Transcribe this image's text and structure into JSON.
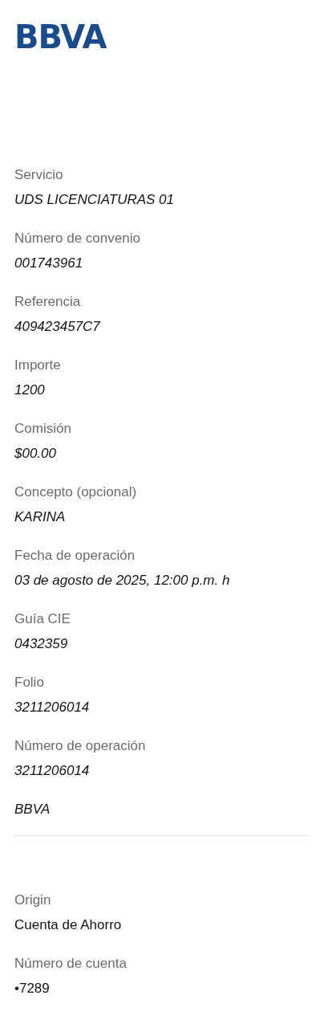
{
  "logo": "BBVA",
  "payment_details": [
    {
      "label": "Servicio",
      "value": "UDS LICENCIATURAS 01"
    },
    {
      "label": "Número de convenio",
      "value": "001743961"
    },
    {
      "label": "Referencia",
      "value": "409423457C7"
    },
    {
      "label": "Importe",
      "value": "1200"
    },
    {
      "label": "Comisión",
      "value": "$00.00"
    },
    {
      "label": "Concepto (opcional)",
      "value": "KARINA"
    },
    {
      "label": "Fecha de operación",
      "value": "03 de agosto de 2025, 12:00 p.m. h"
    },
    {
      "label": "Guía CIE",
      "value": "0432359"
    },
    {
      "label": "Folio",
      "value": "3211206014"
    },
    {
      "label": "Número de operación",
      "value": "3211206014"
    },
    {
      "value": "BBVA"
    }
  ],
  "account_details": [
    {
      "label": "Origin",
      "value": "Cuenta de Ahorro"
    },
    {
      "label": "Número de cuenta",
      "value": "•7289"
    }
  ]
}
